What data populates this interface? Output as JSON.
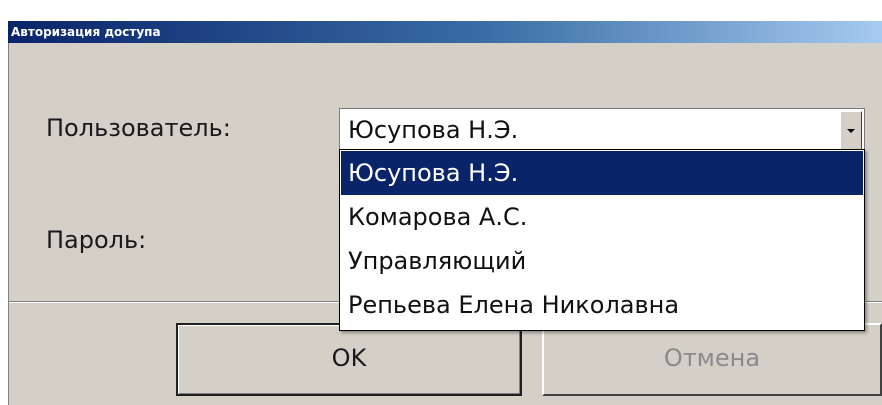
{
  "window": {
    "title": "Авторизация доступа"
  },
  "form": {
    "user_label": "Пользователь:",
    "password_label": "Пароль:",
    "user_combo": {
      "selected_value": "Юсупова Н.Э.",
      "options": [
        "Юсупова Н.Э.",
        "Комарова А.С.",
        "Управляющий",
        "Репьева Елена Николавна"
      ],
      "highlighted_index": 0
    }
  },
  "buttons": {
    "ok_label": "OK",
    "cancel_label": "Отмена"
  },
  "icons": {
    "dropdown": "chevron-down-icon"
  },
  "colors": {
    "selection": "#0a246a",
    "dialog_bg": "#d4d0c8",
    "disabled_text": "#8a8a8a"
  }
}
